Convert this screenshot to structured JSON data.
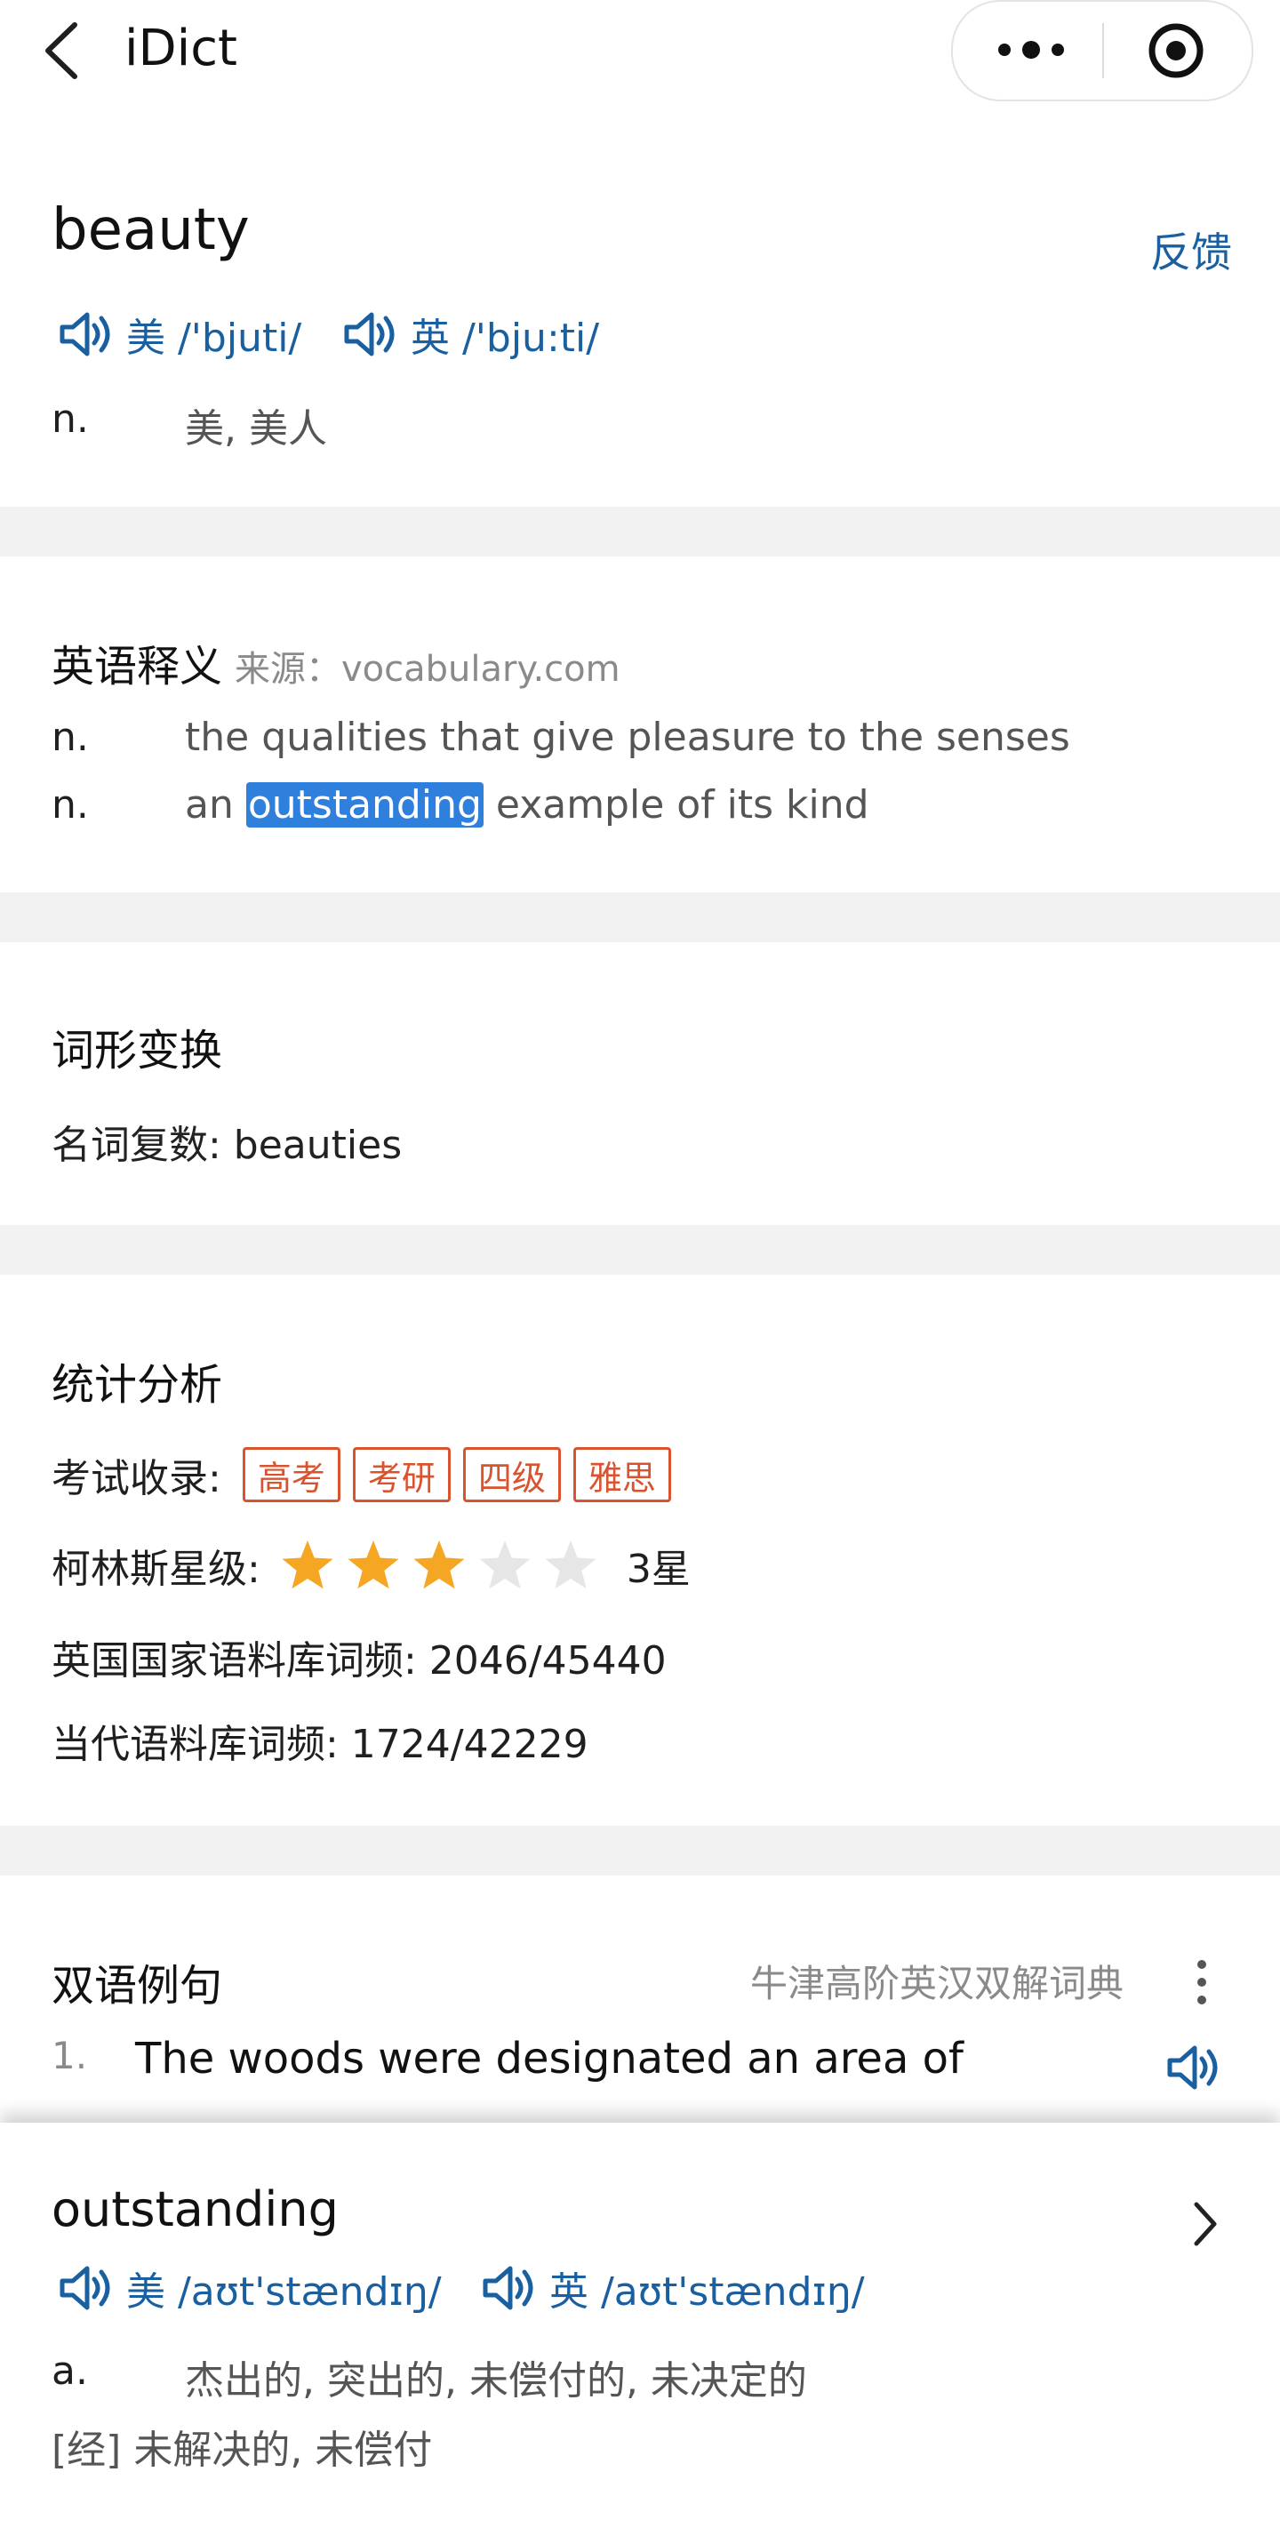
{
  "header": {
    "title": "iDict"
  },
  "word": {
    "headword": "beauty",
    "feedback": "反馈",
    "us_pron": "美 /'bjuti/",
    "uk_pron": "英 /'bju:ti/",
    "defs": [
      {
        "pos": "n.",
        "text": "美, 美人"
      }
    ]
  },
  "english_defs": {
    "title": "英语释义",
    "source": "来源：vocabulary.com",
    "items": [
      {
        "pos": "n.",
        "text": "the qualities that give pleasure to the senses"
      },
      {
        "pos": "n.",
        "before": "an ",
        "highlight": "outstanding",
        "after": " example of its kind"
      }
    ]
  },
  "forms": {
    "title": "词形变换",
    "plural": "名词复数: beauties"
  },
  "stats": {
    "title": "统计分析",
    "exam_label": "考试收录:",
    "exams": [
      "高考",
      "考研",
      "四级",
      "雅思"
    ],
    "collins_label": "柯林斯星级:",
    "stars": 3,
    "max_stars": 5,
    "stars_text": "3星",
    "bnc": "英国国家语料库词频: 2046/45440",
    "coca": "当代语料库词频: 1724/42229"
  },
  "examples": {
    "title": "双语例句",
    "source": "牛津高阶英汉双解词典",
    "items": [
      {
        "num": "1.",
        "text": "The woods were designated an area of"
      }
    ]
  },
  "popup": {
    "word": "outstanding",
    "us_pron": "美 /aʊt'stændɪŋ/",
    "uk_pron": "英 /aʊt'stændɪŋ/",
    "pos": "a.",
    "def": "杰出的, 突出的, 未偿付的, 未决定的",
    "econ": "[经] 未解决的, 未偿付"
  },
  "colors": {
    "accent": "#1a5fa0",
    "star": "#f5a623",
    "star_off": "#e6e6e6",
    "tag": "#d9532f"
  },
  "icons": [
    "back-icon",
    "more-dots-icon",
    "target-icon",
    "speaker-icon",
    "kebab-icon",
    "chevron-right-icon",
    "star-icon"
  ]
}
